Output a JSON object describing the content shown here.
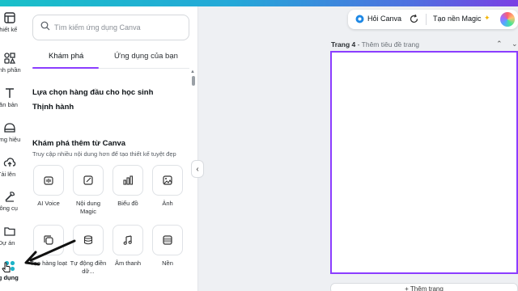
{
  "rail": {
    "items": [
      {
        "label": "Thiết kế",
        "icon": "design-icon"
      },
      {
        "label": "hành phần",
        "icon": "elements-icon"
      },
      {
        "label": "Văn bản",
        "icon": "text-icon"
      },
      {
        "label": "ương hiệu",
        "icon": "brand-icon"
      },
      {
        "label": "Tải lên",
        "icon": "upload-icon"
      },
      {
        "label": "Công cụ",
        "icon": "tools-icon"
      },
      {
        "label": "Dự án",
        "icon": "projects-icon"
      },
      {
        "label": "ng dụng",
        "icon": "apps-icon"
      }
    ]
  },
  "panel": {
    "search_placeholder": "Tìm kiếm ứng dụng Canva",
    "tabs": [
      "Khám phá",
      "Ứng dụng của bạn"
    ],
    "section1": "Lựa chọn hàng đầu cho học sinh",
    "section2": "Thịnh hành",
    "section3": "Khám phá thêm từ Canva",
    "section3_sub": "Truy cập nhiều nội dung hơn để tạo thiết kế tuyệt đẹp",
    "apps_row1": [
      {
        "label": "AI Voice",
        "icon": "ai-voice-icon"
      },
      {
        "label": "Nội dung Magic",
        "icon": "magic-content-icon"
      },
      {
        "label": "Biểu đồ",
        "icon": "chart-icon"
      },
      {
        "label": "Ảnh",
        "icon": "photo-icon"
      }
    ],
    "apps_row2": [
      {
        "label": "Tạo hàng loạt",
        "icon": "bulk-create-icon"
      },
      {
        "label": "Tự động điền dữ...",
        "icon": "autofill-icon"
      },
      {
        "label": "Âm thanh",
        "icon": "audio-icon"
      },
      {
        "label": "Nền",
        "icon": "background-icon"
      }
    ]
  },
  "toolbar": {
    "ask_canva": "Hỏi Canva",
    "magic_create": "Tạo nền Magic"
  },
  "page": {
    "label": "Trang 4",
    "title_placeholder": "Thêm tiêu đề trang"
  },
  "add_page": "+ Thêm trang",
  "colors": {
    "accent": "#8b3dff",
    "top_gradient_start": "#1ac0c9",
    "top_gradient_end": "#7b3fe4"
  }
}
